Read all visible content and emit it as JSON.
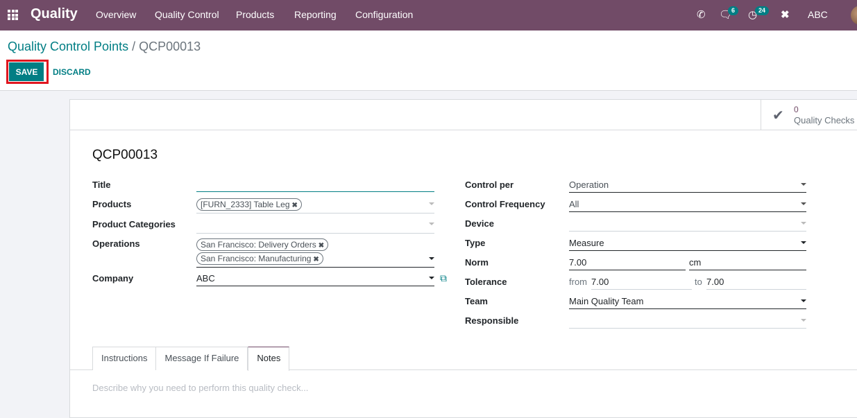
{
  "navbar": {
    "brand": "Quality",
    "menu": [
      "Overview",
      "Quality Control",
      "Products",
      "Reporting",
      "Configuration"
    ],
    "chat_badge": "6",
    "activity_badge": "24",
    "user": "ABC"
  },
  "breadcrumb": {
    "parent": "Quality Control Points",
    "separator": "/",
    "current": "QCP00013"
  },
  "actions": {
    "save": "SAVE",
    "discard": "DISCARD"
  },
  "stat_button": {
    "value": "0",
    "label": "Quality Checks"
  },
  "record": {
    "title": "QCP00013"
  },
  "left_fields": {
    "title_label": "Title",
    "title_value": "",
    "products_label": "Products",
    "products_tags": [
      "[FURN_2333] Table Leg"
    ],
    "categories_label": "Product Categories",
    "operations_label": "Operations",
    "operations_tags": [
      "San Francisco: Delivery Orders",
      "San Francisco: Manufacturing"
    ],
    "company_label": "Company",
    "company_value": "ABC"
  },
  "right_fields": {
    "control_per_label": "Control per",
    "control_per_value": "Operation",
    "frequency_label": "Control Frequency",
    "frequency_value": "All",
    "device_label": "Device",
    "device_value": "",
    "type_label": "Type",
    "type_value": "Measure",
    "norm_label": "Norm",
    "norm_value": "7.00",
    "norm_unit": "cm",
    "tolerance_label": "Tolerance",
    "tolerance_from_label": "from",
    "tolerance_from": "7.00",
    "tolerance_to_label": "to",
    "tolerance_to": "7.00",
    "team_label": "Team",
    "team_value": "Main Quality Team",
    "responsible_label": "Responsible",
    "responsible_value": ""
  },
  "tabs": [
    "Instructions",
    "Message If Failure",
    "Notes"
  ],
  "active_tab": "Notes",
  "notes_placeholder": "Describe why you need to perform this quality check...",
  "colors": {
    "brand": "#714b67",
    "primary": "#017e84",
    "highlight": "#e0161f"
  }
}
